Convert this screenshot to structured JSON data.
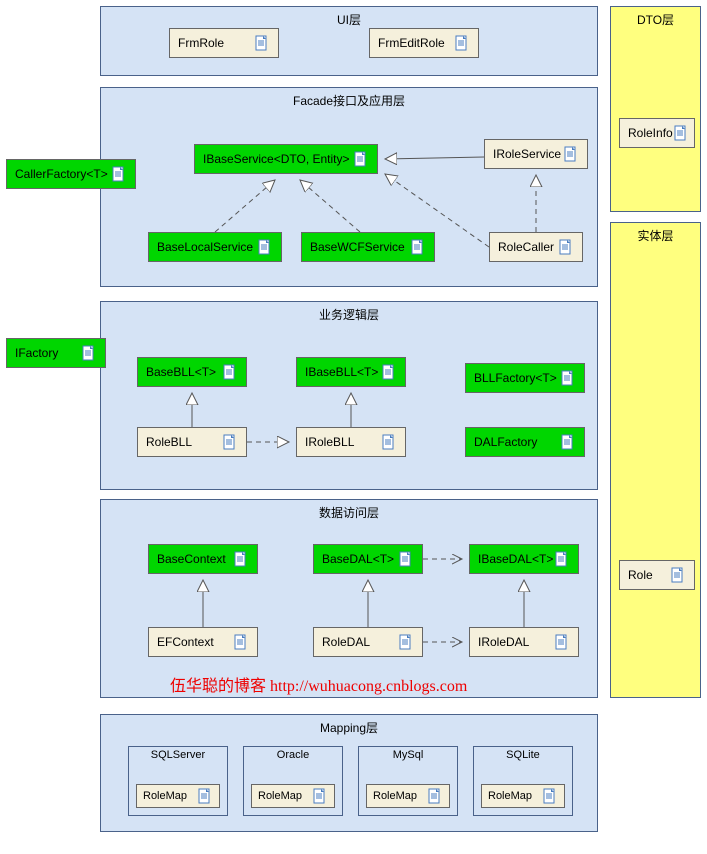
{
  "layers": {
    "ui": {
      "title": "UI层"
    },
    "dto": {
      "title": "DTO层"
    },
    "facade": {
      "title": "Facade接口及应用层"
    },
    "entity": {
      "title": "实体层"
    },
    "bll": {
      "title": "业务逻辑层"
    },
    "dal": {
      "title": "数据访问层"
    },
    "mapping": {
      "title": "Mapping层"
    }
  },
  "nodes": {
    "frmRole": "FrmRole",
    "frmEditRole": "FrmEditRole",
    "roleInfo": "RoleInfo",
    "callerFactory": "CallerFactory<T>",
    "iBaseService": "IBaseService<DTO, Entity>",
    "iRoleService": "IRoleService",
    "baseLocalService": "BaseLocalService",
    "baseWCFService": "BaseWCFService",
    "roleCaller": "RoleCaller",
    "iFactory": "IFactory",
    "baseBLL": "BaseBLL<T>",
    "iBaseBLL": "IBaseBLL<T>",
    "bllFactory": "BLLFactory<T>",
    "roleBLL": "RoleBLL",
    "iRoleBLL": "IRoleBLL",
    "dalFactory": "DALFactory",
    "baseContext": "BaseContext",
    "baseDAL": "BaseDAL<T>",
    "iBaseDAL": "IBaseDAL<T>",
    "efContext": "EFContext",
    "roleDAL": "RoleDAL",
    "iRoleDAL": "IRoleDAL",
    "role": "Role"
  },
  "mapping": {
    "sqlServer": {
      "title": "SQLServer",
      "node": "RoleMap"
    },
    "oracle": {
      "title": "Oracle",
      "node": "RoleMap"
    },
    "mySql": {
      "title": "MySql",
      "node": "RoleMap"
    },
    "sqlite": {
      "title": "SQLite",
      "node": "RoleMap"
    }
  },
  "watermark": "伍华聪的博客 http://wuhuacong.cnblogs.com"
}
